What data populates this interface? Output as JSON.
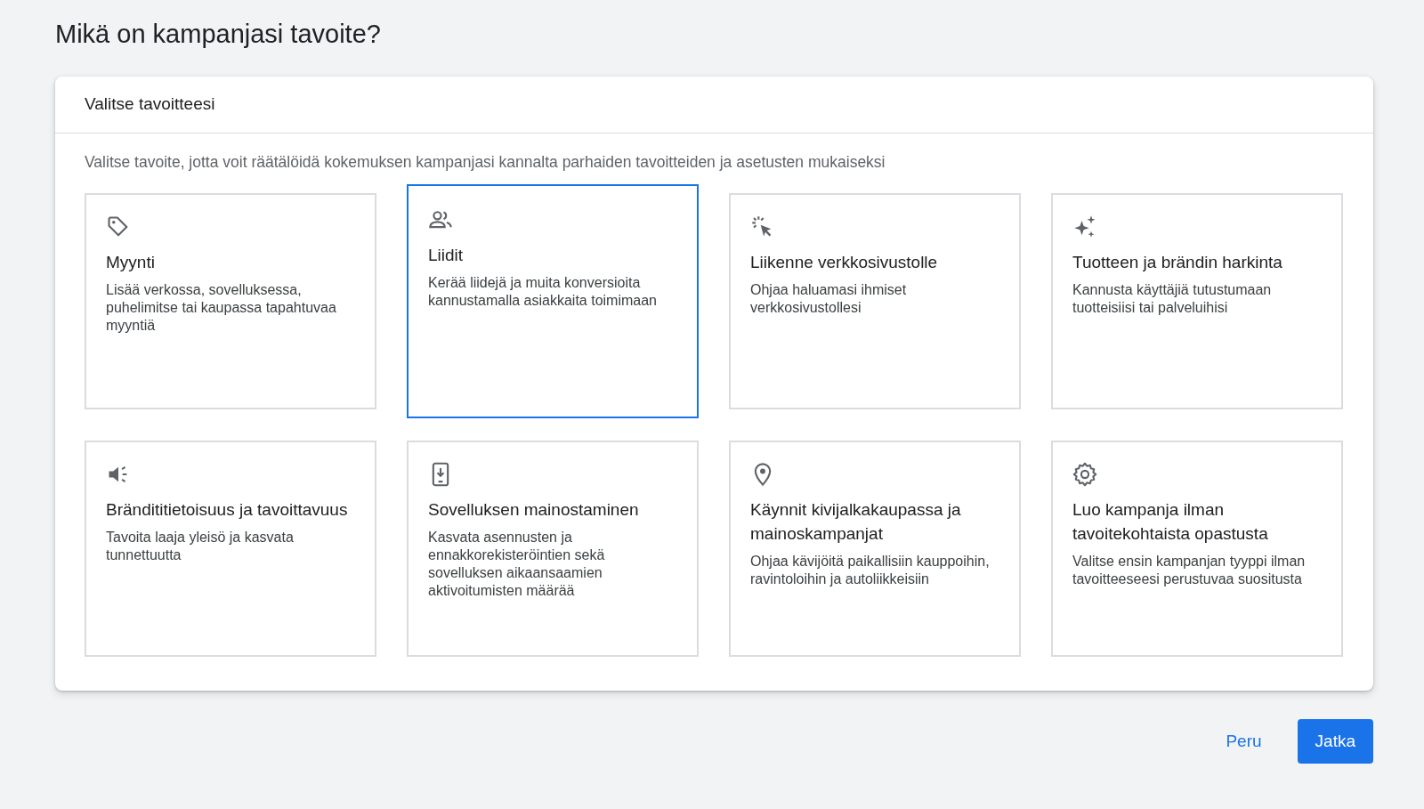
{
  "title": "Mikä on kampanjasi tavoite?",
  "panel": {
    "heading": "Valitse tavoitteesi",
    "description": "Valitse tavoite, jotta voit räätälöidä kokemuksen kampanjasi kannalta parhaiden tavoitteiden ja asetusten mukaiseksi"
  },
  "goals": [
    {
      "title": "Myynti",
      "text": "Lisää verkossa, sovelluksessa, puhelimitse tai kaupassa tapahtuvaa myyntiä",
      "selected": false
    },
    {
      "title": "Liidit",
      "text": "Kerää liidejä ja muita konversioita kannustamalla asiakkaita toimimaan",
      "selected": true
    },
    {
      "title": "Liikenne verkkosivustolle",
      "text": "Ohjaa haluamasi ihmiset verkkosivustollesi",
      "selected": false
    },
    {
      "title": "Tuotteen ja brändin harkinta",
      "text": "Kannusta käyttäjiä tutustumaan tuotteisiisi tai palveluihisi",
      "selected": false
    },
    {
      "title": "Brändititietoisuus ja tavoittavuus",
      "text": "Tavoita laaja yleisö ja kasvata tunnettuutta",
      "selected": false
    },
    {
      "title": "Sovelluksen mainostaminen",
      "text": "Kasvata asennusten ja ennakkorekisteröintien sekä sovelluksen aikaansaamien aktivoitumisten määrää",
      "selected": false
    },
    {
      "title": "Käynnit kivijalkakaupassa ja mainoskampanjat",
      "text": "Ohjaa kävijöitä paikallisiin kauppoihin, ravintoloihin ja autoliikkeisiin",
      "selected": false
    },
    {
      "title": "Luo kampanja ilman tavoitekohtaista opastusta",
      "text": "Valitse ensin kampanjan tyyppi ilman tavoitteeseesi perustuvaa suositusta",
      "selected": false
    }
  ],
  "buttons": {
    "cancel": "Peru",
    "continue": "Jatka"
  }
}
